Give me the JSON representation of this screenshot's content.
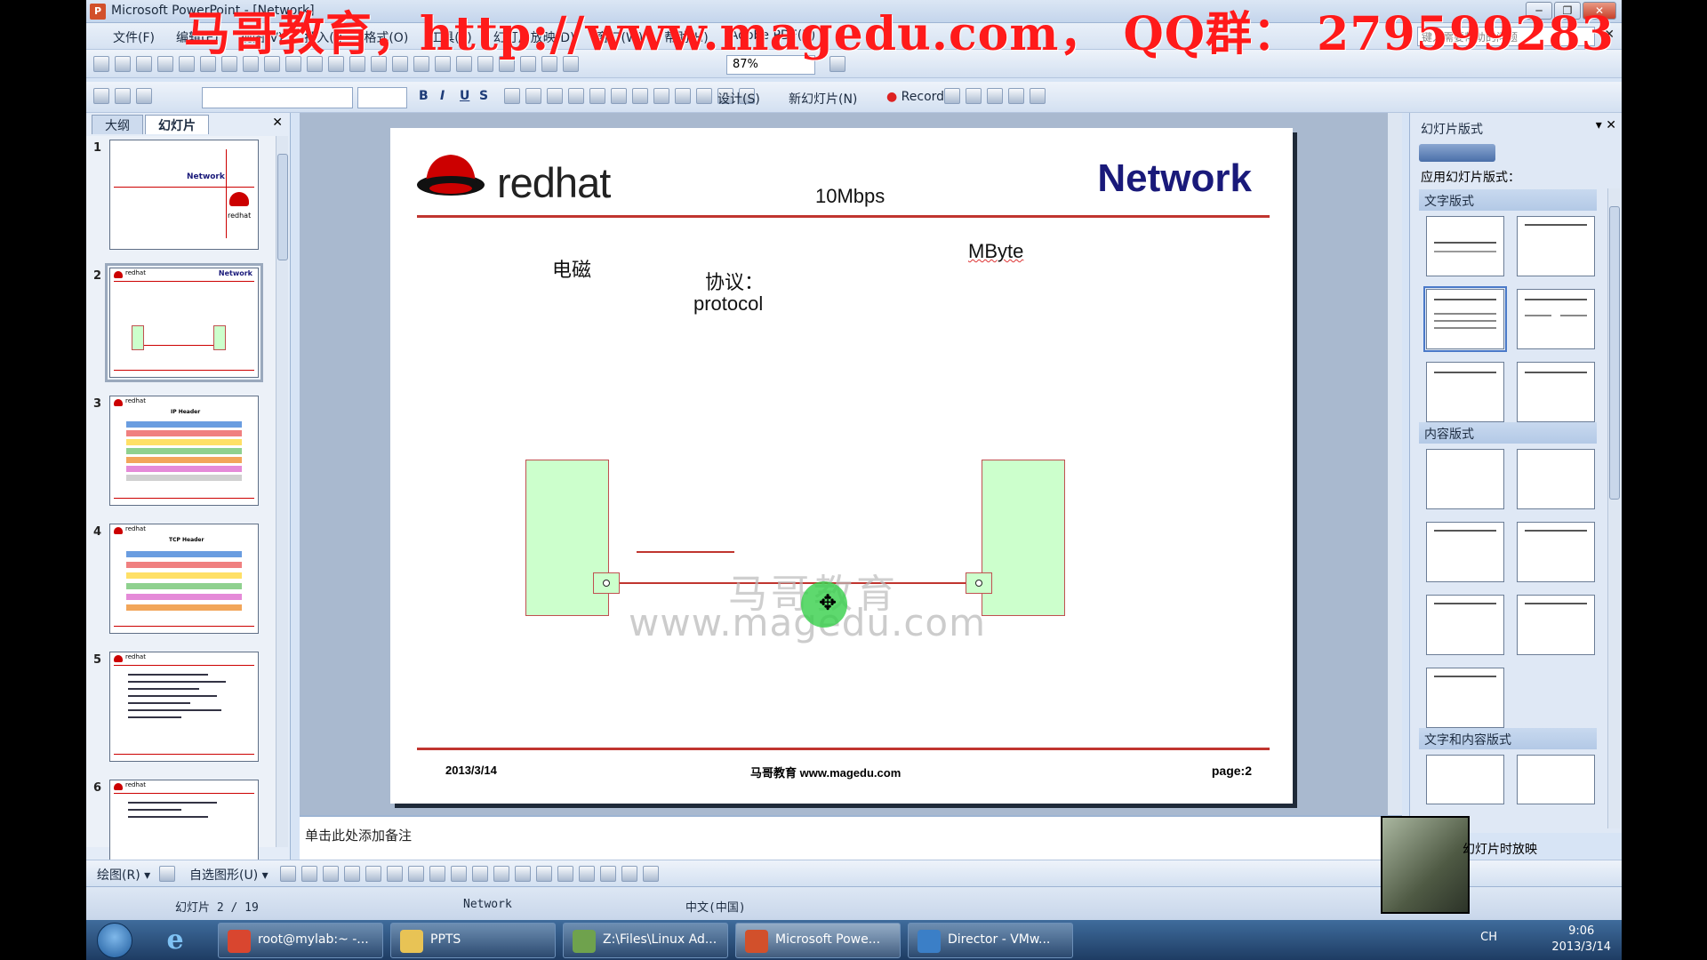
{
  "window": {
    "title": "Microsoft PowerPoint - [Network]",
    "controls": [
      "─",
      "❐",
      "✕"
    ]
  },
  "banner": "马哥教育，http://www.magedu.com， QQ群： 279599283",
  "menubar": {
    "items": [
      "文件(F)",
      "编辑(E)",
      "视图(V)",
      "插入(I)",
      "格式(O)",
      "工具(T)",
      "幻灯片放映(D)",
      "窗口(W)",
      "帮助(H)",
      "Adobe PDF(B)"
    ],
    "help_placeholder": "键入需要帮助的问题",
    "close": "✕"
  },
  "toolbar1": {
    "zoom": "87%"
  },
  "toolbar2": {
    "format_buttons": [
      "B",
      "I",
      "U",
      "S"
    ],
    "design": "设计(S)",
    "new_slide": "新幻灯片(N)",
    "record": "Record"
  },
  "leftpanel": {
    "tab_outline": "大纲",
    "tab_slides": "幻灯片",
    "close": "✕",
    "thumbnails": [
      {
        "num": "1",
        "label": "Network",
        "logo": "redhat"
      },
      {
        "num": "2",
        "label": "Network",
        "logo": "redhat"
      },
      {
        "num": "3",
        "label": "IP Header",
        "logo": "redhat"
      },
      {
        "num": "4",
        "label": "TCP Header",
        "logo": "redhat"
      },
      {
        "num": "5",
        "label": "",
        "logo": "redhat"
      },
      {
        "num": "6",
        "label": "",
        "logo": "redhat"
      }
    ]
  },
  "slide": {
    "logo_word": "redhat",
    "title": "Network",
    "speed": "10Mbps",
    "em_text": "电磁",
    "protocol_label": "协议：",
    "protocol_word": "protocol",
    "unit_text": "MByte",
    "watermark_cn": "马哥教育",
    "watermark_url": "www.magedu.com",
    "footer_date": "2013/3/14",
    "footer_center": "马哥教育 www.magedu.com",
    "footer_page": "page:2"
  },
  "notes": {
    "placeholder": "单击此处添加备注"
  },
  "taskpane": {
    "title": "幻灯片版式",
    "apply_label": "应用幻灯片版式：",
    "section_text": "文字版式",
    "section_content": "内容版式",
    "section_text_content": "文字和内容版式",
    "footer": "幻灯片时放映"
  },
  "drawbar": {
    "draw": "绘图(R) ▾",
    "autoshape": "自选图形(U) ▾"
  },
  "statusbar": {
    "slide_pos": "幻灯片 2 / 19",
    "design": "Network",
    "language": "中文(中国)"
  },
  "taskbar": {
    "items": [
      {
        "label": "root@mylab:~ -...",
        "color": "#d9462f"
      },
      {
        "label": "PPTS",
        "color": "#e8c355"
      },
      {
        "label": "Z:\\Files\\Linux Ad...",
        "color": "#6fa24d"
      },
      {
        "label": "Microsoft Powe...",
        "color": "#d2502b"
      },
      {
        "label": "Director - VMw...",
        "color": "#3b7fc7"
      }
    ],
    "tray_icons": "CH",
    "time": "9:06",
    "date": "2013/3/14"
  }
}
